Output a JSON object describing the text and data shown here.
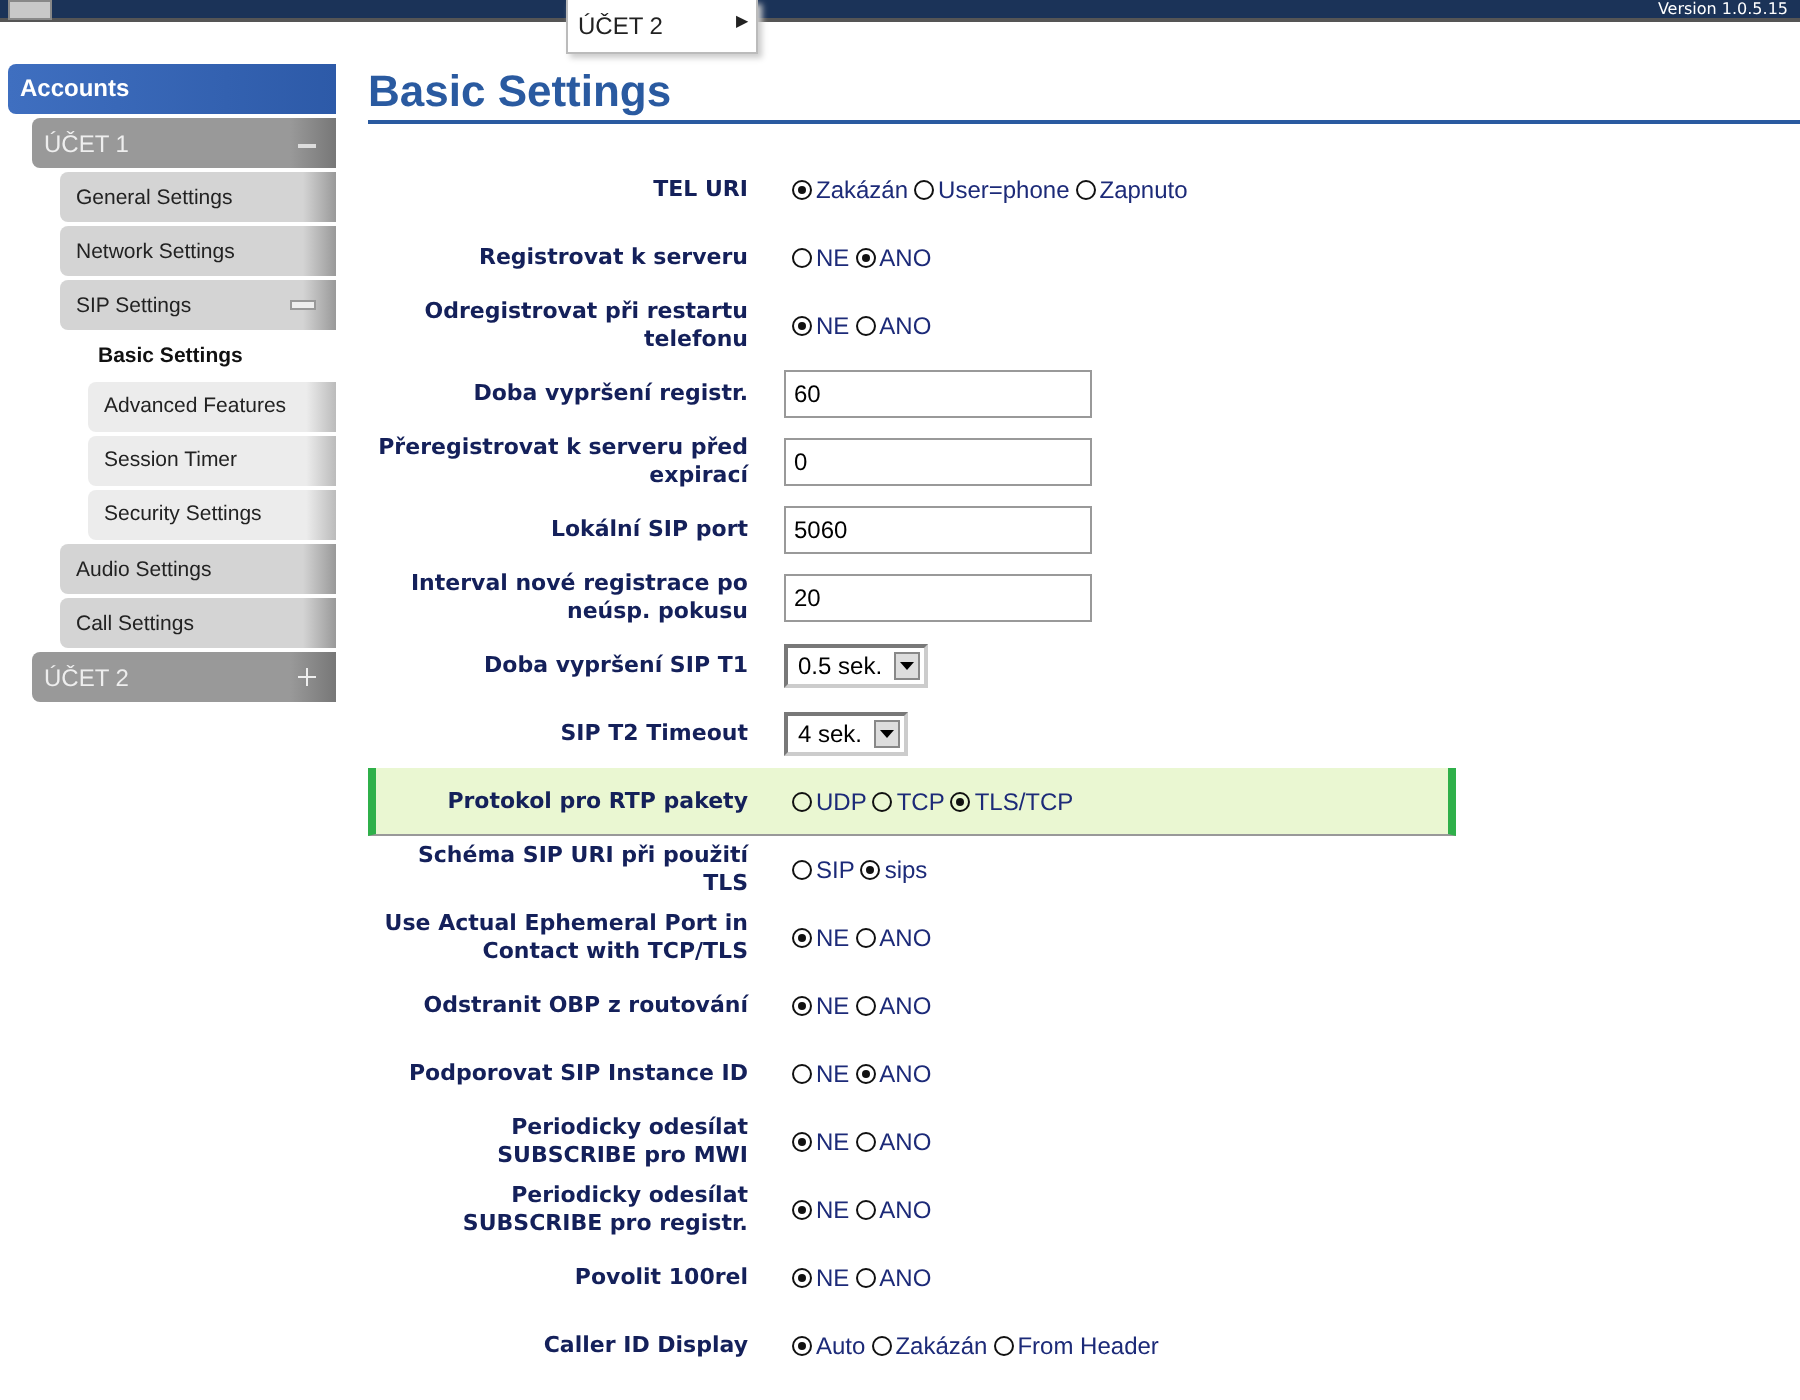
{
  "header": {
    "version": "Version 1.0.5.15"
  },
  "popup_menu": {
    "items": [
      {
        "label": "ÚČET 2",
        "arrow": "▶"
      }
    ]
  },
  "sidebar": {
    "title": "Accounts",
    "items": [
      {
        "label": "ÚČET 1",
        "expanded": true,
        "children": [
          {
            "label": "General Settings",
            "selected": false
          },
          {
            "label": "Network Settings",
            "selected": false
          },
          {
            "label": "SIP Settings",
            "expanded": true,
            "selected": false,
            "children": [
              {
                "label": "Basic Settings",
                "selected": true
              },
              {
                "label": "Advanced Features",
                "selected": false
              },
              {
                "label": "Session Timer",
                "selected": false
              },
              {
                "label": "Security Settings",
                "selected": false
              }
            ]
          },
          {
            "label": "Audio Settings",
            "selected": false
          },
          {
            "label": "Call Settings",
            "selected": false
          }
        ]
      },
      {
        "label": "ÚČET 2",
        "expanded": false
      }
    ]
  },
  "page_title": "Basic Settings",
  "settings": [
    {
      "label": "TEL URI",
      "kind": "radio",
      "highlighted": false,
      "options": [
        {
          "label": "Zakázán",
          "selected": true
        },
        {
          "label": "User=phone",
          "selected": false
        },
        {
          "label": "Zapnuto",
          "selected": false
        }
      ]
    },
    {
      "label": "Registrovat k serveru",
      "kind": "radio",
      "highlighted": false,
      "options": [
        {
          "label": "NE",
          "selected": false
        },
        {
          "label": "ANO",
          "selected": true
        }
      ]
    },
    {
      "label": "Odregistrovat při restartu telefonu",
      "kind": "radio",
      "highlighted": false,
      "options": [
        {
          "label": "NE",
          "selected": true
        },
        {
          "label": "ANO",
          "selected": false
        }
      ]
    },
    {
      "label": "Doba vypršení registr.",
      "kind": "text",
      "highlighted": false,
      "value": "60"
    },
    {
      "label": "Přeregistrovat k serveru před expirací",
      "kind": "text",
      "highlighted": false,
      "value": "0"
    },
    {
      "label": "Lokální SIP port",
      "kind": "text",
      "highlighted": false,
      "value": "5060"
    },
    {
      "label": "Interval nové registrace po neúsp. pokusu",
      "kind": "text",
      "highlighted": false,
      "value": "20"
    },
    {
      "label": "Doba vypršení SIP T1",
      "kind": "select",
      "highlighted": false,
      "value": "0.5 sek."
    },
    {
      "label": "SIP T2 Timeout",
      "kind": "select",
      "highlighted": false,
      "value": "4 sek."
    },
    {
      "label": "Protokol pro RTP pakety",
      "kind": "radio",
      "highlighted": true,
      "options": [
        {
          "label": "UDP",
          "selected": false
        },
        {
          "label": "TCP",
          "selected": false
        },
        {
          "label": "TLS/TCP",
          "selected": true
        }
      ]
    },
    {
      "label": "Schéma SIP URI při použití TLS",
      "kind": "radio",
      "highlighted": false,
      "options": [
        {
          "label": "SIP",
          "selected": false
        },
        {
          "label": "sips",
          "selected": true
        }
      ]
    },
    {
      "label": "Use Actual Ephemeral Port in Contact with TCP/TLS",
      "kind": "radio",
      "highlighted": false,
      "options": [
        {
          "label": "NE",
          "selected": true
        },
        {
          "label": "ANO",
          "selected": false
        }
      ]
    },
    {
      "label": "Odstranit OBP z routování",
      "kind": "radio",
      "highlighted": false,
      "options": [
        {
          "label": "NE",
          "selected": true
        },
        {
          "label": "ANO",
          "selected": false
        }
      ]
    },
    {
      "label": "Podporovat SIP Instance ID",
      "kind": "radio",
      "highlighted": false,
      "options": [
        {
          "label": "NE",
          "selected": false
        },
        {
          "label": "ANO",
          "selected": true
        }
      ]
    },
    {
      "label": "Periodicky odesílat SUBSCRIBE pro MWI",
      "kind": "radio",
      "highlighted": false,
      "options": [
        {
          "label": "NE",
          "selected": true
        },
        {
          "label": "ANO",
          "selected": false
        }
      ]
    },
    {
      "label": "Periodicky odesílat SUBSCRIBE pro registr.",
      "kind": "radio",
      "highlighted": false,
      "options": [
        {
          "label": "NE",
          "selected": true
        },
        {
          "label": "ANO",
          "selected": false
        }
      ]
    },
    {
      "label": "Povolit 100rel",
      "kind": "radio",
      "highlighted": false,
      "options": [
        {
          "label": "NE",
          "selected": true
        },
        {
          "label": "ANO",
          "selected": false
        }
      ]
    },
    {
      "label": "Caller ID Display",
      "kind": "radio",
      "highlighted": false,
      "options": [
        {
          "label": "Auto",
          "selected": true
        },
        {
          "label": "Zakázán",
          "selected": false
        },
        {
          "label": "From Header",
          "selected": false
        }
      ]
    }
  ]
}
